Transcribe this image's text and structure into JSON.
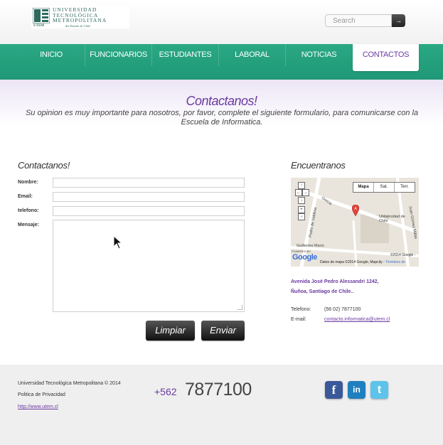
{
  "header": {
    "logo": {
      "name_lines": [
        "UNIVERSIDAD",
        "TECNOLÓGICA",
        "METROPOLITANA"
      ],
      "acronym": "UTEM",
      "tagline": "del Estado de Chile"
    },
    "search": {
      "placeholder": "Search",
      "button": "→"
    }
  },
  "nav": {
    "items": [
      {
        "label": "INICIO"
      },
      {
        "label": "FUNCIONARIOS"
      },
      {
        "label": "ESTUDIANTES"
      },
      {
        "label": "LABORAL"
      },
      {
        "label": "NOTICIAS"
      },
      {
        "label": "CONTACTOS",
        "active": true
      }
    ]
  },
  "intro": {
    "title": "Contactanos!",
    "text": "Su opinion es muy importante para nosotros, por favor, complete el siguiente formulario, para comunicarse con la Escuela de Informatica."
  },
  "form": {
    "heading": "Contactanos!",
    "labels": {
      "name": "Nombre:",
      "email": "Email:",
      "phone": "telefono:",
      "message": "Mensaje:"
    },
    "values": {
      "name": "",
      "email": "",
      "phone": "",
      "message": ""
    },
    "buttons": {
      "clear": "Limpiar",
      "send": "Enviar"
    }
  },
  "location": {
    "heading": "Encuentranos",
    "map": {
      "tabs": [
        "Mapa",
        "Sat.",
        "Terr."
      ],
      "selected_tab": "Mapa",
      "labels": {
        "street1": "Grecia",
        "street2": "Pedro de Valdivia",
        "street3": "Guillermo Mann",
        "street4": "Juan Gómez Millas",
        "place": "Universidad de Chile",
        "powered": "POWERED BY",
        "google": "Google",
        "copyright_top": "©2014 Google -",
        "copyright_bottom": "Datos de mapa ©2014 Google, Mapcity -",
        "terms": "Términos de"
      }
    },
    "address_line1": "Avenida José Pedro Alessandri 1242,",
    "address_line2": "Ñuñoa, Santiago de Chile..",
    "phone_label": "Telefono:",
    "phone_value": "(56 02) 7877100",
    "email_label": "E-mail:",
    "email_value": "contacto.informatica@utem.cl"
  },
  "footer": {
    "copyright": "Universidad Tecnológica Metropolitana © 2014",
    "privacy": "Politica de Privacidad",
    "url": "http://www.utem.cl",
    "phone_prefix": "+562",
    "phone_number": "7877100",
    "social": [
      {
        "name": "facebook",
        "glyph": "f",
        "color": "#3b5998"
      },
      {
        "name": "linkedin",
        "glyph": "in",
        "color": "#1f7fbf"
      },
      {
        "name": "twitter",
        "glyph": "t",
        "color": "#5ec3ea"
      }
    ]
  },
  "colors": {
    "accent_green": "#22a07d",
    "accent_purple": "#6b3aa0",
    "footer_bg": "#efefef"
  }
}
